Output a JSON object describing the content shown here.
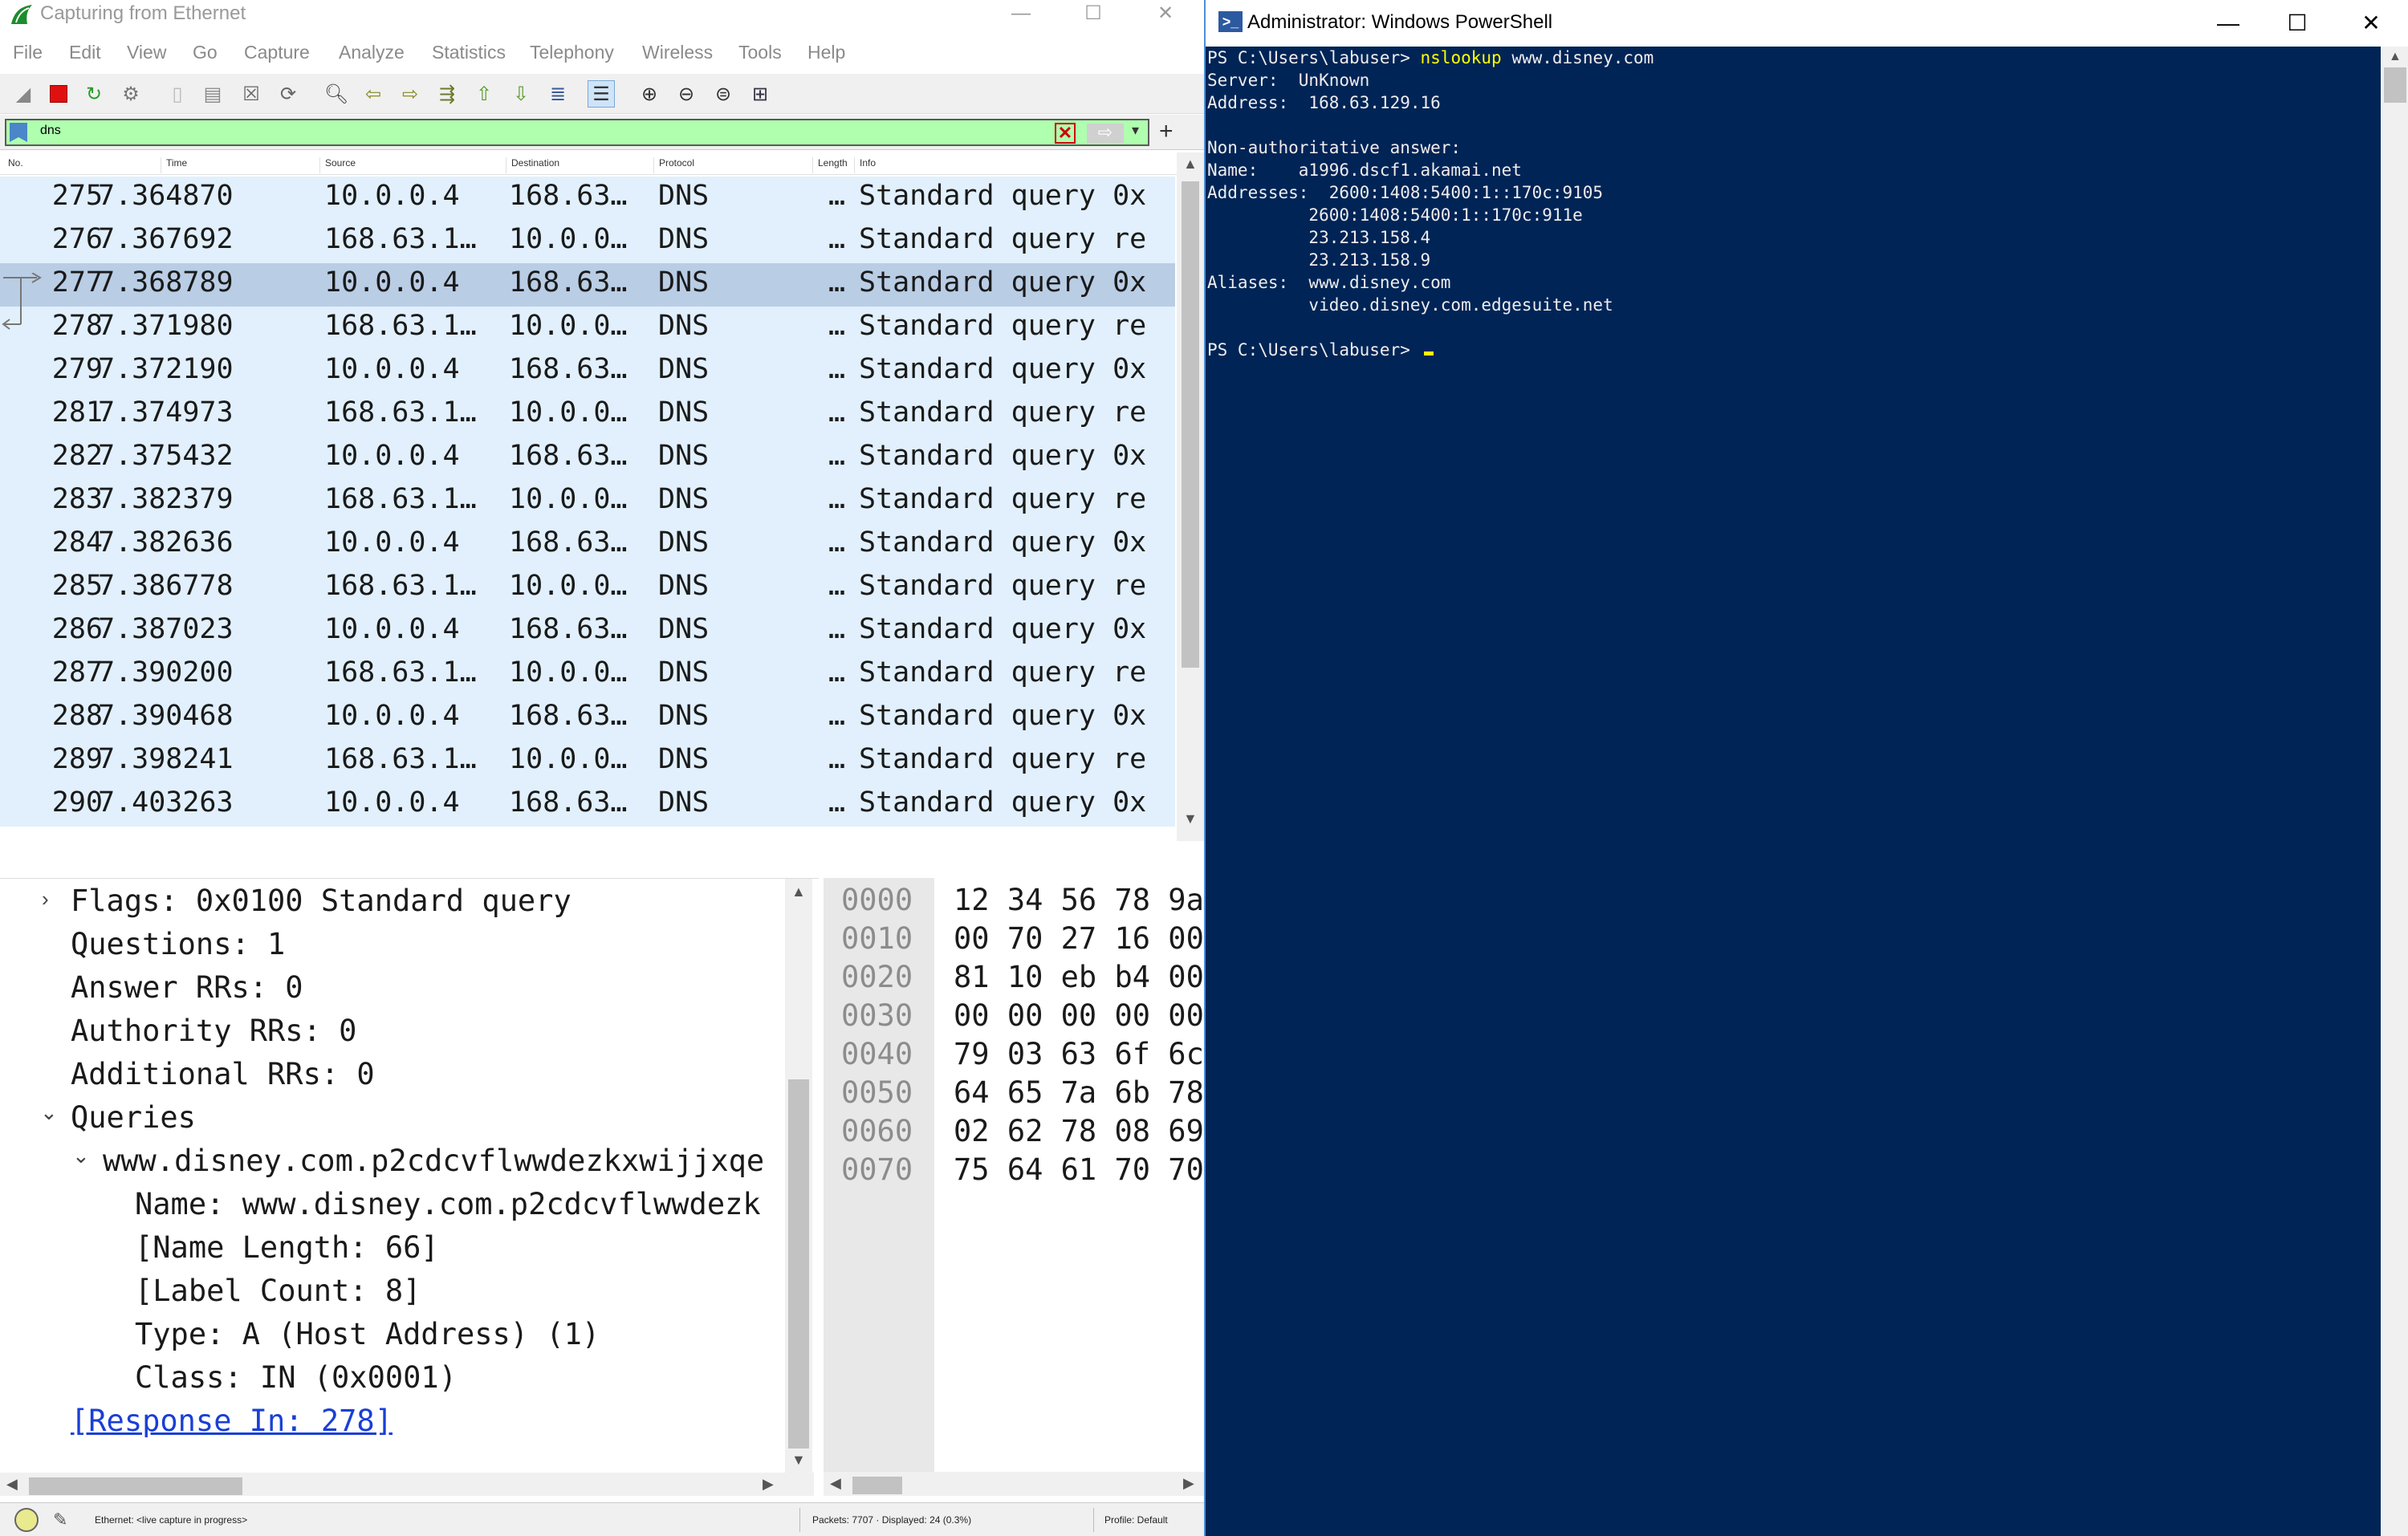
{
  "wireshark": {
    "title": "Capturing from Ethernet",
    "menu": [
      "File",
      "Edit",
      "View",
      "Go",
      "Capture",
      "Analyze",
      "Statistics",
      "Telephony",
      "Wireless",
      "Tools",
      "Help"
    ],
    "filter": {
      "value": "dns"
    },
    "columns": [
      "No.",
      "Time",
      "Source",
      "Destination",
      "Protocol",
      "Length",
      "Info"
    ],
    "packets": [
      {
        "no": "275",
        "time": "7.364870",
        "src": "10.0.0.4",
        "dst": "168.63…",
        "proto": "DNS",
        "len": "…",
        "info": "Standard query 0x"
      },
      {
        "no": "276",
        "time": "7.367692",
        "src": "168.63.1…",
        "dst": "10.0.0…",
        "proto": "DNS",
        "len": "…",
        "info": "Standard query re"
      },
      {
        "no": "277",
        "time": "7.368789",
        "src": "10.0.0.4",
        "dst": "168.63…",
        "proto": "DNS",
        "len": "…",
        "info": "Standard query 0x"
      },
      {
        "no": "278",
        "time": "7.371980",
        "src": "168.63.1…",
        "dst": "10.0.0…",
        "proto": "DNS",
        "len": "…",
        "info": "Standard query re"
      },
      {
        "no": "279",
        "time": "7.372190",
        "src": "10.0.0.4",
        "dst": "168.63…",
        "proto": "DNS",
        "len": "…",
        "info": "Standard query 0x"
      },
      {
        "no": "281",
        "time": "7.374973",
        "src": "168.63.1…",
        "dst": "10.0.0…",
        "proto": "DNS",
        "len": "…",
        "info": "Standard query re"
      },
      {
        "no": "282",
        "time": "7.375432",
        "src": "10.0.0.4",
        "dst": "168.63…",
        "proto": "DNS",
        "len": "…",
        "info": "Standard query 0x"
      },
      {
        "no": "283",
        "time": "7.382379",
        "src": "168.63.1…",
        "dst": "10.0.0…",
        "proto": "DNS",
        "len": "…",
        "info": "Standard query re"
      },
      {
        "no": "284",
        "time": "7.382636",
        "src": "10.0.0.4",
        "dst": "168.63…",
        "proto": "DNS",
        "len": "…",
        "info": "Standard query 0x"
      },
      {
        "no": "285",
        "time": "7.386778",
        "src": "168.63.1…",
        "dst": "10.0.0…",
        "proto": "DNS",
        "len": "…",
        "info": "Standard query re"
      },
      {
        "no": "286",
        "time": "7.387023",
        "src": "10.0.0.4",
        "dst": "168.63…",
        "proto": "DNS",
        "len": "…",
        "info": "Standard query 0x"
      },
      {
        "no": "287",
        "time": "7.390200",
        "src": "168.63.1…",
        "dst": "10.0.0…",
        "proto": "DNS",
        "len": "…",
        "info": "Standard query re"
      },
      {
        "no": "288",
        "time": "7.390468",
        "src": "10.0.0.4",
        "dst": "168.63…",
        "proto": "DNS",
        "len": "…",
        "info": "Standard query 0x"
      },
      {
        "no": "289",
        "time": "7.398241",
        "src": "168.63.1…",
        "dst": "10.0.0…",
        "proto": "DNS",
        "len": "…",
        "info": "Standard query re"
      },
      {
        "no": "290",
        "time": "7.403263",
        "src": "10.0.0.4",
        "dst": "168.63…",
        "proto": "DNS",
        "len": "…",
        "info": "Standard query 0x"
      }
    ],
    "selected_packet": "277",
    "details": [
      "Flags: 0x0100 Standard query",
      "Questions: 1",
      "Answer RRs: 0",
      "Authority RRs: 0",
      "Additional RRs: 0",
      "Queries",
      "www.disney.com.p2cdcvflwwdezkxwijjxqe",
      "Name: www.disney.com.p2cdcvflwwdezk",
      "[Name Length: 66]",
      "[Label Count: 8]",
      "Type: A (Host Address) (1)",
      "Class: IN (0x0001)",
      "[Response In: 278]"
    ],
    "bytes": [
      {
        "off": "0000",
        "hex": "12 34 56 78 9a"
      },
      {
        "off": "0010",
        "hex": "00 70 27 16 00"
      },
      {
        "off": "0020",
        "hex": "81 10 eb b4 00"
      },
      {
        "off": "0030",
        "hex": "00 00 00 00 00"
      },
      {
        "off": "0040",
        "hex": "79 03 63 6f 6c"
      },
      {
        "off": "0050",
        "hex": "64 65 7a 6b 78"
      },
      {
        "off": "0060",
        "hex": "02 62 78 08 69"
      },
      {
        "off": "0070",
        "hex": "75 64 61 70 70"
      }
    ],
    "status": {
      "interface": "Ethernet: <live capture in progress>",
      "packets": "Packets: 7707 · Displayed: 24 (0.3%)",
      "profile": "Profile: Default"
    },
    "colors": {
      "row_bg": "#e1f0fc",
      "row_selected": "#b9cde5",
      "filter_ok": "#afffaf"
    }
  },
  "powershell": {
    "title": "Administrator: Windows PowerShell",
    "lines": {
      "l1_prompt": "PS C:\\Users\\labuser> ",
      "l1_cmd": "nslookup",
      "l1_arg": " www.disney.com",
      "l2": "Server:  UnKnown",
      "l3": "Address:  168.63.129.16",
      "l4": "",
      "l5": "Non-authoritative answer:",
      "l6": "Name:    a1996.dscf1.akamai.net",
      "l7": "Addresses:  2600:1408:5400:1::170c:9105",
      "l8": "          2600:1408:5400:1::170c:911e",
      "l9": "          23.213.158.4",
      "l10": "          23.213.158.9",
      "l11": "Aliases:  www.disney.com",
      "l12": "          video.disney.com.edgesuite.net",
      "l13": "",
      "l14_prompt": "PS C:\\Users\\labuser> "
    },
    "colors": {
      "bg": "#012456",
      "text": "#eeeded",
      "cmd": "#ffff00"
    }
  }
}
